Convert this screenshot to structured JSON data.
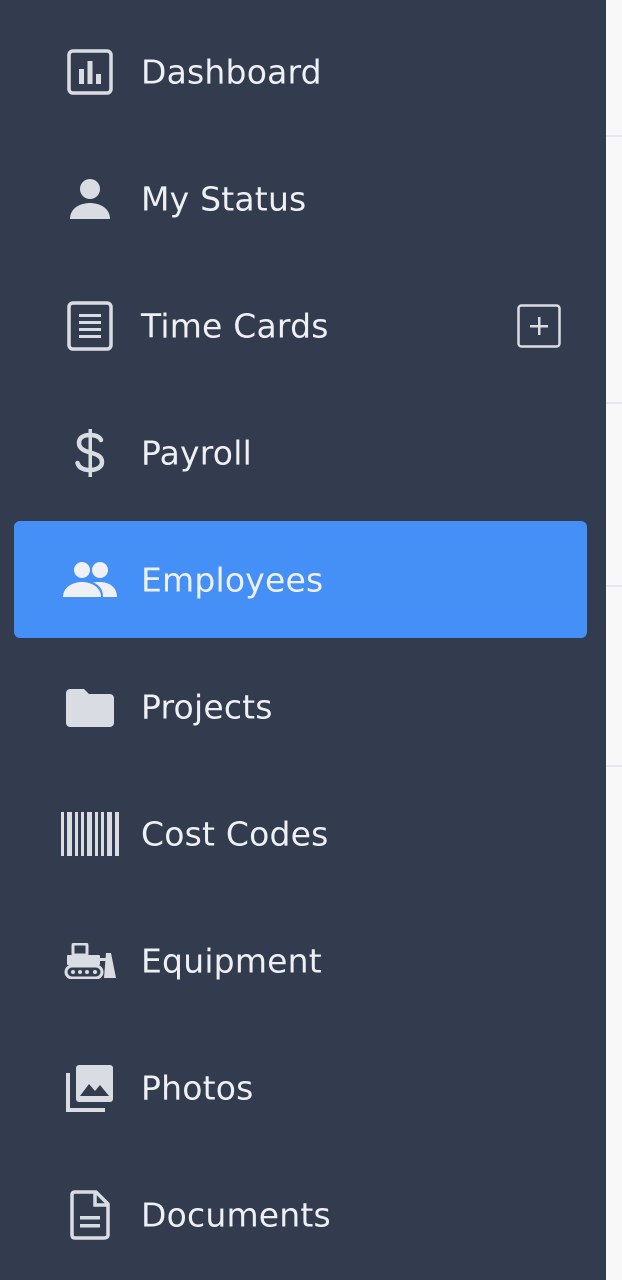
{
  "sidebar": {
    "items": [
      {
        "label": "Dashboard",
        "icon": "dashboard-icon"
      },
      {
        "label": "My Status",
        "icon": "person-icon"
      },
      {
        "label": "Time Cards",
        "icon": "document-lines-icon",
        "action_icon": "add-square-icon"
      },
      {
        "label": "Payroll",
        "icon": "dollar-icon"
      },
      {
        "label": "Employees",
        "icon": "people-icon",
        "active": true
      },
      {
        "label": "Projects",
        "icon": "folder-icon"
      },
      {
        "label": "Cost Codes",
        "icon": "barcode-icon"
      },
      {
        "label": "Equipment",
        "icon": "bulldozer-icon"
      },
      {
        "label": "Photos",
        "icon": "photo-library-icon"
      },
      {
        "label": "Documents",
        "icon": "document-icon"
      }
    ]
  },
  "colors": {
    "sidebar_bg": "#323c4e",
    "active_bg": "#4590f7",
    "text": "#eef0f3",
    "icon": "#d9dde3"
  }
}
